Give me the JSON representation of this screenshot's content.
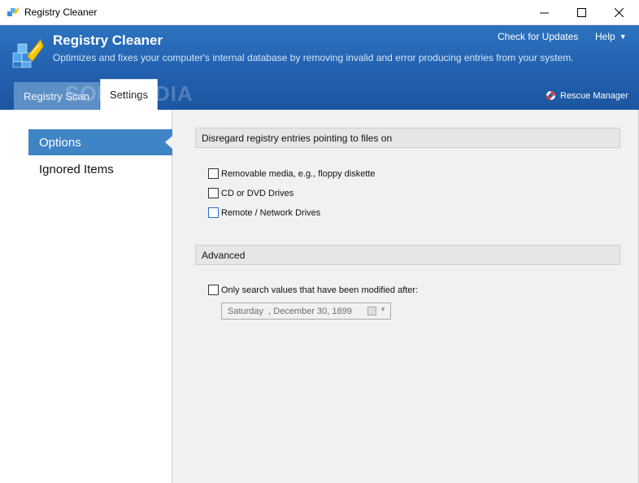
{
  "window": {
    "title": "Registry Cleaner",
    "minimize_glyph": "—",
    "maximize_glyph": "☐",
    "close_glyph": "✕"
  },
  "header": {
    "app_name": "Registry Cleaner",
    "subtitle": "Optimizes and fixes your computer's internal database by removing invalid and error producing entries from your system.",
    "check_updates": "Check for Updates",
    "help": "Help",
    "help_caret": "▼",
    "rescue_manager": "Rescue Manager",
    "watermark": "SOFTPEDIA",
    "tabs": [
      {
        "label": "Registry Scan",
        "active": false
      },
      {
        "label": "Settings",
        "active": true
      }
    ],
    "brand_color": "#215fad"
  },
  "sidebar": {
    "items": [
      {
        "label": "Options",
        "selected": true
      },
      {
        "label": "Ignored Items",
        "selected": false
      }
    ],
    "selected_color": "#3f84c5"
  },
  "main": {
    "section1": {
      "title": "Disregard registry entries pointing to files on",
      "options": [
        {
          "label": "Removable media, e.g., floppy diskette",
          "checked": false
        },
        {
          "label": "CD or DVD Drives",
          "checked": false
        },
        {
          "label": "Remote / Network Drives",
          "checked": false
        }
      ]
    },
    "section2": {
      "title": "Advanced",
      "option": {
        "label": "Only search values that have been modified after:",
        "checked": false
      },
      "date_value": "Saturday  , December 30, 1899"
    }
  }
}
